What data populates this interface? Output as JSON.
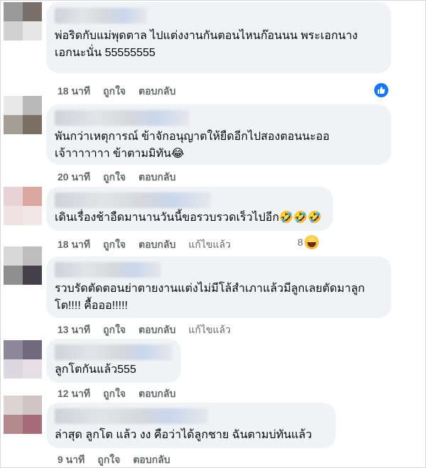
{
  "comments": [
    {
      "text_lines": [
        "พ่อริดกับแม่พุดตาล ไปแต่งงานกันตอนไหนก๊อนนน พระเอกนาง",
        "เอกนะนั่น 55555555"
      ],
      "time": "18 นาที",
      "like": "ถูกใจ",
      "reply": "ตอบกลับ",
      "edited": "",
      "reaction": "like",
      "reaction_count": "",
      "avatar_colors": [
        "#9a9a9a",
        "#7a6f6a",
        "#d2d2d2",
        "#e6e6e6"
      ]
    },
    {
      "text_lines": [
        "พันกว่าเหตุการณ์ ข้าจักอนุญาตให้ยืดอีกไปสองตอนนะออ",
        "เจ้าาาาาาา ข้าตามมิทัน😂"
      ],
      "time": "20 นาที",
      "like": "ถูกใจ",
      "reply": "ตอบกลับ",
      "edited": "",
      "reaction": "",
      "reaction_count": "",
      "avatar_colors": [
        "#e8e8e8",
        "#b9b9b9",
        "#a59e97",
        "#7b6e62"
      ]
    },
    {
      "text_lines": [
        "เดินเรื่องช้าอืดมานานวันนี้ขอรวบรวดเร็วไปอีก🤣🤣🤣"
      ],
      "time": "18 นาที",
      "like": "ถูกใจ",
      "reply": "ตอบกลับ",
      "edited": "แก้ไขแล้ว",
      "reaction": "haha",
      "reaction_count": "8",
      "avatar_colors": [
        "#e7d3d6",
        "#d9a79e",
        "#f0e2e2",
        "#f3e6e6"
      ]
    },
    {
      "text_lines": [
        "รวบรัดตัดตอนย่าตายงานแต่งไม่มีโล้สำเภาแล้วมีลูกเลยตัดมาลูก",
        "โต!!!! คื้อออ!!!!!"
      ],
      "time": "13 นาที",
      "like": "ถูกใจ",
      "reply": "ตอบกลับ",
      "edited": "แก้ไขแล้ว",
      "reaction": "",
      "reaction_count": "",
      "avatar_colors": [
        "#d8d8d8",
        "#bdbdbd",
        "#8f8f8f",
        "#454049"
      ]
    },
    {
      "text_lines": [
        "ลูกโตกันแล้ว555"
      ],
      "time": "12 นาที",
      "like": "ถูกใจ",
      "reply": "ตอบกลับ",
      "edited": "",
      "reaction": "",
      "reaction_count": "",
      "avatar_colors": [
        "#8f879b",
        "#6f6a7d",
        "#dcd8e2",
        "#e7dde4"
      ]
    },
    {
      "text_lines": [
        "ล่าสุด ลูกโต แล้ว งง คือว่าได้ลูกชาย ฉันตามบ่ทันแล้ว"
      ],
      "time": "9 นาที",
      "like": "ถูกใจ",
      "reply": "ตอบกลับ",
      "edited": "",
      "reaction": "",
      "reaction_count": "",
      "avatar_colors": [
        "#dcd3d3",
        "#cfc3c3",
        "#b48a8d",
        "#a86b7a"
      ]
    }
  ],
  "colors": {
    "bubble": "#f0f2f5",
    "text": "#050505",
    "meta": "#65676b",
    "like_blue": "#1877f2"
  }
}
